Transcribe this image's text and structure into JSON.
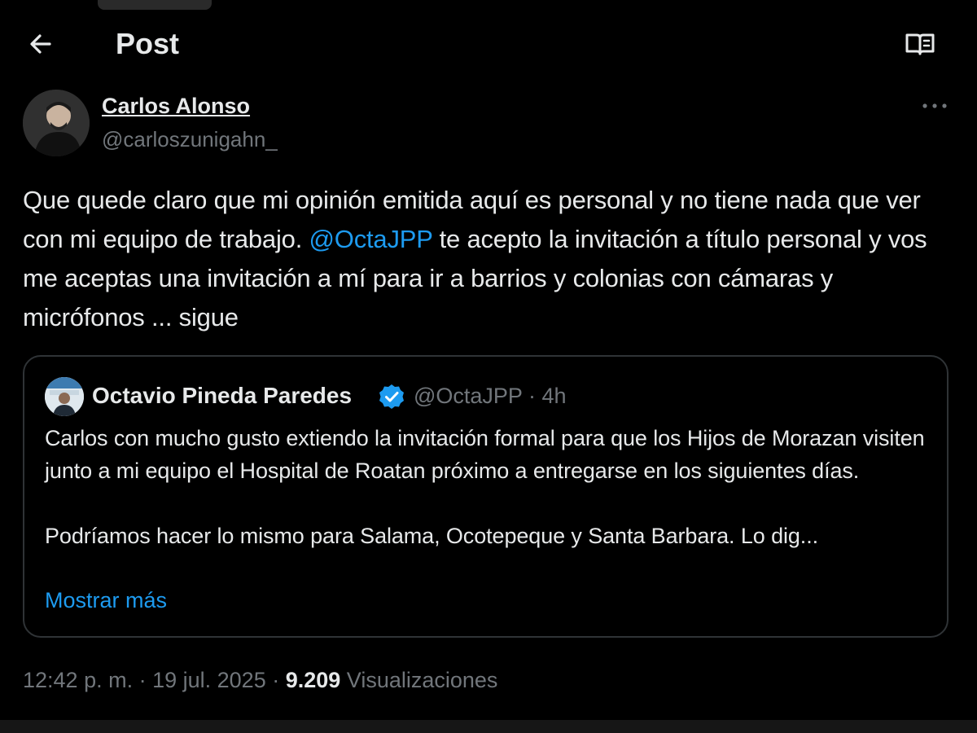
{
  "header": {
    "title": "Post",
    "back_icon": "arrow-left-icon",
    "reader_icon": "book-open-icon"
  },
  "author": {
    "name": "Carlos Alonso",
    "handle": "@carloszunigahn_",
    "avatar_icon": "avatar-icon",
    "more_icon": "ellipsis-icon"
  },
  "tweet": {
    "text_part1": "Que quede claro que mi opinión emitida aquí es personal y no tiene nada que ver con mi equipo de trabajo. ",
    "mention": "@OctaJPP",
    "text_part2": " te acepto la invitación a título personal y vos me aceptas una invitación a mí para ir a barrios y colonias con cámaras y micrófonos ... sigue"
  },
  "quote": {
    "name": "Octavio Pineda Paredes",
    "verified_icon": "verified-badge-icon",
    "handle": "@OctaJPP",
    "separator": "·",
    "time": "4h",
    "paragraph1": "Carlos con mucho gusto extiendo la invitación formal para que los Hijos de Morazan visiten junto a mi equipo el Hospital de Roatan próximo a entregarse en los siguientes días.",
    "paragraph2": "Podríamos hacer lo mismo para Salama, Ocotepeque y Santa Barbara. Lo dig...",
    "show_more": "Mostrar más"
  },
  "meta": {
    "time": "12:42 p. m.",
    "sep1": " · ",
    "date": "19 jul. 2025",
    "sep2": " · ",
    "views_count": "9.209",
    "views_label": " Visualizaciones"
  },
  "colors": {
    "background": "#000000",
    "text": "#e7e9ea",
    "secondary": "#71767b",
    "accent": "#1d9bf0",
    "border": "#2f3336"
  }
}
